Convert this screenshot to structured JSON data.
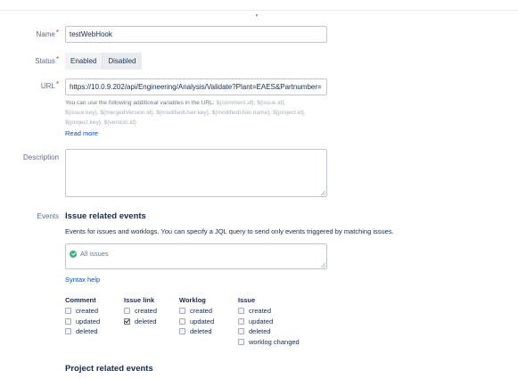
{
  "form": {
    "name": {
      "label": "Name",
      "required_mark": "*",
      "value": "testWebHook"
    },
    "status": {
      "label": "Status",
      "required_mark": "*",
      "options": [
        "Enabled",
        "Disabled"
      ],
      "selected": "Enabled"
    },
    "url": {
      "label": "URL",
      "required_mark": "*",
      "value": "https://10.0.9.202/api/Engineering/Analysis/Validate?Plant=EAES&Partnumber=",
      "help_prefix": "You can use the following additional variables in the URL:",
      "variables_line1": "${comment.id}, ${issue.id},",
      "variables_line2": "${issue.key}, ${mergedVersion.id}, ${modifiedUser.key}, ${modifiedUser.name}, ${project.id},",
      "variables_line3": "${project.key}, ${version.id}",
      "read_more": "Read more"
    },
    "description": {
      "label": "Description",
      "value": ""
    },
    "events": {
      "label": "Events",
      "issue_section_title": "Issue related events",
      "issue_section_desc": "Events for issues and worklogs. You can specify a JQL query to send only events triggered by matching issues.",
      "jql_value": "All issues",
      "syntax_help": "Syntax help",
      "groups": [
        {
          "title": "Comment",
          "items": [
            {
              "label": "created",
              "checked": false
            },
            {
              "label": "updated",
              "checked": false
            },
            {
              "label": "deleted",
              "checked": false
            }
          ]
        },
        {
          "title": "Issue link",
          "items": [
            {
              "label": "created",
              "checked": false
            },
            {
              "label": "deleted",
              "checked": true
            }
          ]
        },
        {
          "title": "Worklog",
          "items": [
            {
              "label": "created",
              "checked": false
            },
            {
              "label": "updated",
              "checked": false
            },
            {
              "label": "deleted",
              "checked": false
            }
          ]
        },
        {
          "title": "Issue",
          "items": [
            {
              "label": "created",
              "checked": false
            },
            {
              "label": "updated",
              "checked": false
            },
            {
              "label": "deleted",
              "checked": false
            },
            {
              "label": "worklog changed",
              "checked": false
            }
          ]
        }
      ],
      "project_section_title": "Project related events"
    }
  },
  "colors": {
    "link": "#0052cc",
    "required": "#de350b",
    "success": "#36b37e",
    "border": "#c1c7d0"
  }
}
